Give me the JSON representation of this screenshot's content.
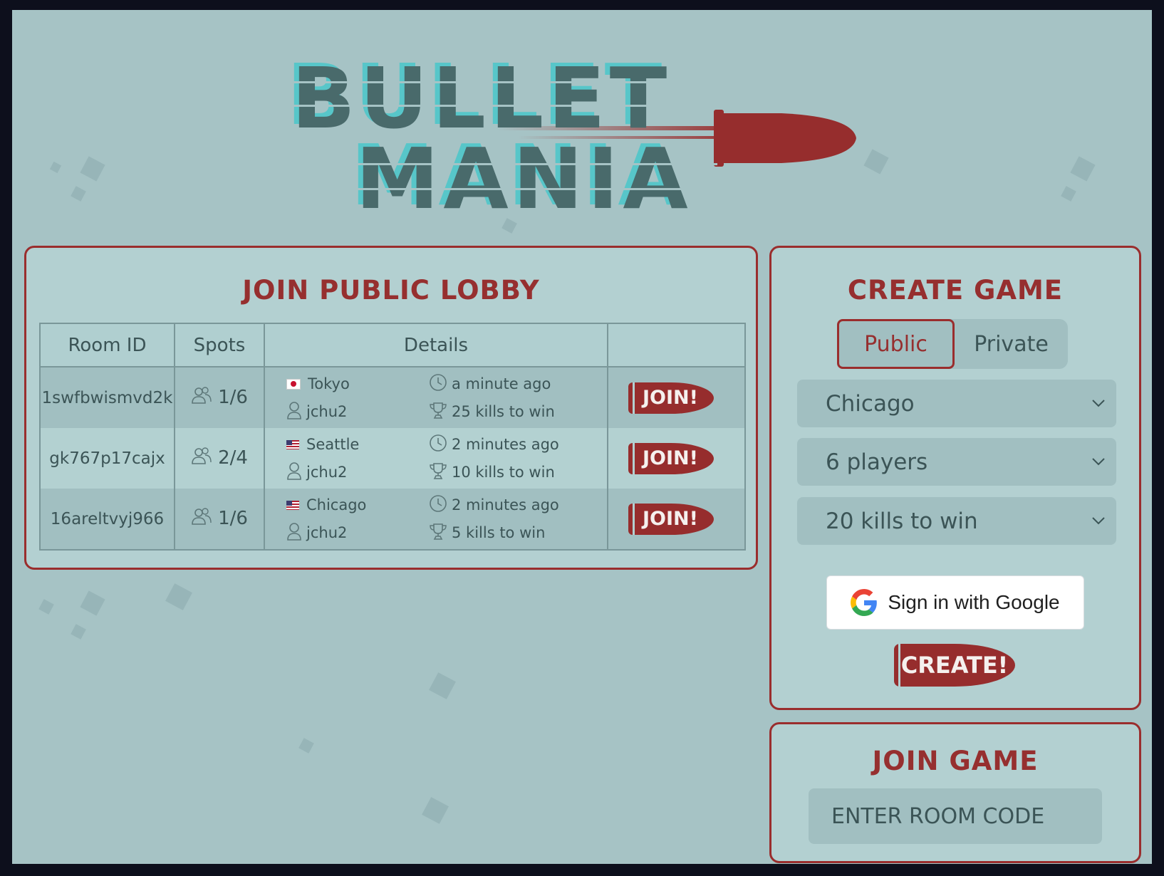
{
  "logo": {
    "line1": "BULLET",
    "line2": "MANIA"
  },
  "lobby": {
    "title": "JOIN PUBLIC LOBBY",
    "headers": {
      "room_id": "Room ID",
      "spots": "Spots",
      "details": "Details",
      "action": ""
    },
    "rows": [
      {
        "room_id": "1swfbwismvd2k",
        "spots": "1/6",
        "flag": "jp",
        "city": "Tokyo",
        "host": "jchu2",
        "time": "a minute ago",
        "goal": "25 kills to win",
        "join_label": "JOIN!"
      },
      {
        "room_id": "gk767p17cajx",
        "spots": "2/4",
        "flag": "us",
        "city": "Seattle",
        "host": "jchu2",
        "time": "2 minutes ago",
        "goal": "10 kills to win",
        "join_label": "JOIN!"
      },
      {
        "room_id": "16areltvyj966",
        "spots": "1/6",
        "flag": "us",
        "city": "Chicago",
        "host": "jchu2",
        "time": "2 minutes ago",
        "goal": "5 kills to win",
        "join_label": "JOIN!"
      }
    ]
  },
  "create": {
    "title": "CREATE GAME",
    "visibility": {
      "public": "Public",
      "private": "Private",
      "selected": "public"
    },
    "region": "Chicago",
    "players": "6 players",
    "kills": "20 kills to win",
    "google_label": "Sign in with Google",
    "create_label": "CREATE!"
  },
  "join": {
    "title": "JOIN GAME",
    "placeholder": "ENTER ROOM CODE"
  },
  "colors": {
    "accent": "#962f2f",
    "background": "#a6c3c5",
    "panel": "#b3d0d1",
    "text": "#3b5456"
  }
}
